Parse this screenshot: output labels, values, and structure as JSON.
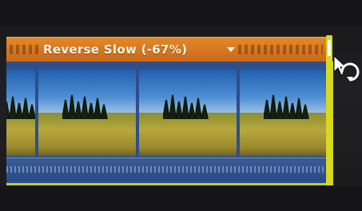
{
  "retime": {
    "label": "Reverse Slow (-67%)",
    "color": "#d97a22"
  },
  "clip": {
    "frame_count": 4,
    "border_color": "#c8cc1e"
  },
  "icons": {
    "dropdown": "chevron-down-icon",
    "cursor": "retime-cursor-icon"
  }
}
